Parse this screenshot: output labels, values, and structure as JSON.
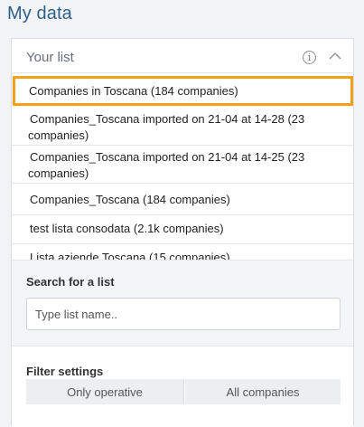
{
  "page": {
    "title": "My data"
  },
  "list_panel": {
    "title": "Your list",
    "info_icon": "i",
    "items": [
      {
        "label": "Companies in Toscana (184 companies)",
        "selected": true
      },
      {
        "label": "Companies_Toscana imported on 21-04 at 14-28 (23 companies)",
        "selected": false
      },
      {
        "label": "Companies_Toscana imported on 21-04 at 14-25 (23 companies)",
        "selected": false
      },
      {
        "label": "Companies_Toscana (184 companies)",
        "selected": false
      },
      {
        "label": "test lista consodata (2.1k companies)",
        "selected": false
      },
      {
        "label": "Lista aziende Toscana (15 companies)",
        "selected": false
      }
    ]
  },
  "search": {
    "label": "Search for a list",
    "placeholder": "Type list name.."
  },
  "filter": {
    "label": "Filter settings",
    "options": [
      "Only operative",
      "All companies"
    ]
  },
  "colors": {
    "title": "#2f5f8a",
    "selection_border": "#f4a01a"
  },
  "icons": {
    "info": "info-icon",
    "collapse": "chevron-up-icon"
  }
}
